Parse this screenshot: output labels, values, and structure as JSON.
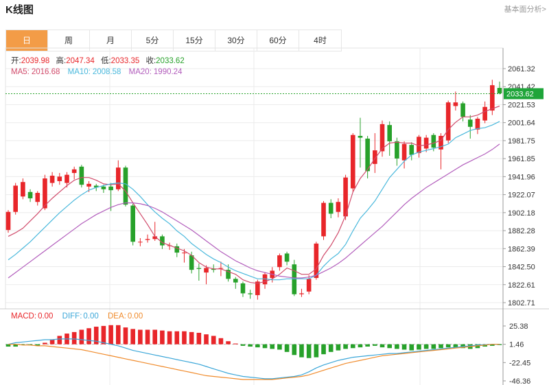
{
  "header": {
    "title": "K线图",
    "more_link": "基本面分析>"
  },
  "tabs": [
    {
      "label": "日",
      "active": true
    },
    {
      "label": "周",
      "active": false
    },
    {
      "label": "月",
      "active": false
    },
    {
      "label": "5分",
      "active": false
    },
    {
      "label": "15分",
      "active": false
    },
    {
      "label": "30分",
      "active": false
    },
    {
      "label": "60分",
      "active": false
    },
    {
      "label": "4时",
      "active": false
    }
  ],
  "ohlc_legend": {
    "open_label": "开:",
    "open": "2039.98",
    "high_label": "高:",
    "high": "2047.34",
    "low_label": "低:",
    "low": "2033.35",
    "close_label": "收:",
    "close": "2033.62"
  },
  "ma_legend": {
    "ma5_label": "MA5:",
    "ma5": "2016.68",
    "ma10_label": "MA10:",
    "ma10": "2008.58",
    "ma20_label": "MA20:",
    "ma20": "1990.24"
  },
  "macd_legend": {
    "macd_label": "MACD:",
    "macd": "0.00",
    "diff_label": "DIFF:",
    "diff": "0.00",
    "dea_label": "DEA:",
    "dea": "0.00"
  },
  "colors": {
    "up": "#e8262a",
    "down": "#27a12a",
    "ma5": "#d04a6a",
    "ma10": "#49b8dc",
    "ma20": "#b25dbc",
    "diff": "#3aa6d8",
    "dea": "#f08a2a",
    "last_price_bg": "#1fa53a",
    "grid": "#ebebeb"
  },
  "chart_data": [
    {
      "type": "candlestick",
      "ylim": [
        1802.71,
        2061.32
      ],
      "yticks": [
        2061.32,
        2041.42,
        2021.53,
        2001.64,
        1981.75,
        1961.85,
        1941.96,
        1922.07,
        1902.18,
        1882.28,
        1862.39,
        1842.5,
        1822.61,
        1802.71
      ],
      "last_price": 2033.62,
      "candles": [
        [
          1883,
          1903,
          1880,
          1905
        ],
        [
          1903,
          1932,
          1900,
          1935
        ],
        [
          1920,
          1936,
          1917,
          1940
        ],
        [
          1925,
          1918,
          1914,
          1928
        ],
        [
          1914,
          1924,
          1910,
          1926
        ],
        [
          1907,
          1940,
          1905,
          1944
        ],
        [
          1935,
          1943,
          1931,
          1947
        ],
        [
          1937,
          1942,
          1933,
          1946
        ],
        [
          1935,
          1944,
          1930,
          1947
        ],
        [
          1946,
          1950,
          1939,
          1953
        ],
        [
          1953,
          1933,
          1930,
          1955
        ],
        [
          1931,
          1934,
          1925,
          1937
        ],
        [
          1932,
          1930,
          1926,
          1934
        ],
        [
          1931,
          1928,
          1924,
          1933
        ],
        [
          1931,
          1927,
          1904,
          1935
        ],
        [
          1928,
          1952,
          1926,
          1960
        ],
        [
          1952,
          1911,
          1909,
          1954
        ],
        [
          1910,
          1870,
          1866,
          1912
        ],
        [
          1870,
          1870,
          1865,
          1874
        ],
        [
          1872,
          1873,
          1869,
          1878
        ],
        [
          1873,
          1876,
          1871,
          1892
        ],
        [
          1876,
          1866,
          1862,
          1878
        ],
        [
          1866,
          1866,
          1861,
          1869
        ],
        [
          1865,
          1858,
          1853,
          1868
        ],
        [
          1858,
          1858,
          1847,
          1862
        ],
        [
          1855,
          1839,
          1835,
          1859
        ],
        [
          1841,
          1840,
          1827,
          1846
        ],
        [
          1836,
          1841,
          1823,
          1844
        ],
        [
          1840,
          1839,
          1836,
          1845
        ],
        [
          1841,
          1841,
          1832,
          1848
        ],
        [
          1839,
          1829,
          1826,
          1845
        ],
        [
          1829,
          1825,
          1818,
          1831
        ],
        [
          1824,
          1813,
          1809,
          1826
        ],
        [
          1813,
          1812,
          1807,
          1817
        ],
        [
          1811,
          1826,
          1806,
          1828
        ],
        [
          1823,
          1834,
          1818,
          1836
        ],
        [
          1830,
          1838,
          1825,
          1842
        ],
        [
          1842,
          1855,
          1838,
          1857
        ],
        [
          1857,
          1848,
          1844,
          1859
        ],
        [
          1845,
          1812,
          1810,
          1850
        ],
        [
          1812,
          1813,
          1809,
          1818
        ],
        [
          1815,
          1829,
          1812,
          1833
        ],
        [
          1830,
          1868,
          1828,
          1870
        ],
        [
          1876,
          1913,
          1872,
          1915
        ],
        [
          1913,
          1901,
          1896,
          1917
        ],
        [
          1903,
          1914,
          1897,
          1918
        ],
        [
          1898,
          1941,
          1894,
          1944
        ],
        [
          1929,
          1988,
          1925,
          1990
        ],
        [
          1987,
          1985,
          1952,
          2007
        ],
        [
          1984,
          1948,
          1940,
          1987
        ],
        [
          1956,
          1971,
          1946,
          1990
        ],
        [
          1970,
          2000,
          1964,
          2004
        ],
        [
          1999,
          1981,
          1965,
          2003
        ],
        [
          1981,
          1962,
          1954,
          1985
        ],
        [
          1960,
          1978,
          1951,
          1981
        ],
        [
          1977,
          1966,
          1960,
          1980
        ],
        [
          1968,
          1986,
          1963,
          1988
        ],
        [
          1973,
          1985,
          1969,
          1988
        ],
        [
          1988,
          1974,
          1970,
          1990
        ],
        [
          1972,
          1987,
          1950,
          1990
        ],
        [
          1982,
          2024,
          1979,
          2026
        ],
        [
          2020,
          2024,
          2015,
          2036
        ],
        [
          2023,
          2008,
          2003,
          2025
        ],
        [
          2005,
          1997,
          1984,
          2010
        ],
        [
          1994,
          2006,
          1989,
          2008
        ],
        [
          2004,
          2019,
          2001,
          2025
        ],
        [
          2015,
          2043,
          2010,
          2049
        ],
        [
          2040,
          2034,
          2033,
          2047
        ]
      ],
      "ma5": [
        1876,
        1880,
        1885,
        1893,
        1901,
        1910,
        1918,
        1925,
        1932,
        1938,
        1941,
        1941,
        1938,
        1934,
        1933,
        1934,
        1926,
        1913,
        1901,
        1889,
        1876,
        1869,
        1866,
        1863,
        1860,
        1855,
        1847,
        1842,
        1840,
        1840,
        1837,
        1834,
        1828,
        1825,
        1824,
        1826,
        1829,
        1834,
        1841,
        1838,
        1834,
        1834,
        1840,
        1855,
        1866,
        1880,
        1899,
        1925,
        1940,
        1950,
        1962,
        1973,
        1979,
        1980,
        1979,
        1979,
        1976,
        1977,
        1979,
        1982,
        1994,
        2002,
        2008,
        2008,
        2010,
        2014,
        2017,
        2020
      ],
      "ma10": [
        1850,
        1856,
        1863,
        1870,
        1878,
        1886,
        1894,
        1902,
        1909,
        1916,
        1922,
        1927,
        1930,
        1932,
        1934,
        1935,
        1934,
        1928,
        1920,
        1911,
        1903,
        1896,
        1890,
        1882,
        1876,
        1868,
        1862,
        1856,
        1851,
        1847,
        1842,
        1838,
        1835,
        1832,
        1829,
        1829,
        1828,
        1828,
        1829,
        1829,
        1829,
        1829,
        1833,
        1843,
        1851,
        1857,
        1867,
        1882,
        1896,
        1905,
        1915,
        1928,
        1941,
        1950,
        1959,
        1966,
        1969,
        1971,
        1973,
        1975,
        1978,
        1985,
        1989,
        1993,
        1995,
        1996,
        1999,
        2003
      ],
      "ma20": [
        1830,
        1836,
        1842,
        1848,
        1854,
        1860,
        1866,
        1872,
        1878,
        1884,
        1890,
        1895,
        1900,
        1904,
        1908,
        1911,
        1913,
        1913,
        1912,
        1910,
        1907,
        1903,
        1898,
        1893,
        1888,
        1883,
        1877,
        1871,
        1865,
        1859,
        1854,
        1849,
        1845,
        1841,
        1838,
        1836,
        1834,
        1832,
        1831,
        1830,
        1830,
        1831,
        1833,
        1837,
        1841,
        1846,
        1852,
        1859,
        1866,
        1873,
        1880,
        1887,
        1895,
        1903,
        1911,
        1918,
        1924,
        1930,
        1935,
        1940,
        1945,
        1950,
        1955,
        1959,
        1963,
        1967,
        1972,
        1978
      ]
    },
    {
      "type": "macd",
      "ylim": [
        -46.36,
        25.38
      ],
      "yticks": [
        25.38,
        1.46,
        -22.45,
        -46.36
      ],
      "hist": [
        -3,
        -3,
        -1,
        -1,
        -2,
        2,
        6,
        11,
        14,
        16,
        19,
        21,
        23,
        24,
        25,
        25,
        22,
        20,
        19,
        19,
        19,
        18,
        17,
        17,
        17,
        16,
        15,
        13,
        11,
        8,
        4,
        1,
        -2,
        -3,
        -4,
        -5,
        -6,
        -7,
        -10,
        -14,
        -17,
        -18,
        -17,
        -13,
        -10,
        -8,
        -6,
        -5,
        -4,
        -3,
        -2,
        -4,
        -5,
        -6,
        -7,
        -8,
        -7,
        -6,
        -6,
        -5,
        -4,
        -4,
        -5,
        -6,
        -5,
        -3,
        -2,
        -1
      ],
      "diff": [
        0,
        2,
        3,
        4,
        5,
        6,
        6,
        7,
        7,
        7,
        6,
        5,
        4,
        2,
        0,
        -2,
        -5,
        -8,
        -10,
        -12,
        -14,
        -16,
        -18,
        -20,
        -22,
        -24,
        -26,
        -29,
        -32,
        -35,
        -38,
        -40,
        -42,
        -43,
        -44,
        -45,
        -45,
        -44,
        -43,
        -42,
        -40,
        -36,
        -31,
        -27,
        -24,
        -21,
        -19,
        -17,
        -16,
        -15,
        -14,
        -13,
        -12,
        -12,
        -11,
        -10,
        -9,
        -8,
        -7,
        -6,
        -5,
        -4,
        -3,
        -2,
        -1,
        -0.5,
        0,
        0
      ],
      "dea": [
        0,
        0,
        -1,
        -1,
        -2,
        -2,
        -3,
        -4,
        -5,
        -6,
        -7,
        -9,
        -11,
        -13,
        -15,
        -17,
        -19,
        -21,
        -23,
        -25,
        -27,
        -29,
        -31,
        -33,
        -35,
        -37,
        -39,
        -41,
        -42,
        -43,
        -44,
        -45,
        -46,
        -46,
        -46,
        -46,
        -46,
        -45,
        -44,
        -43,
        -42,
        -40,
        -37,
        -34,
        -31,
        -28,
        -25,
        -23,
        -21,
        -19,
        -17,
        -15,
        -14,
        -13,
        -12,
        -11,
        -10,
        -9,
        -8,
        -7,
        -6,
        -5,
        -4,
        -3,
        -2,
        -1,
        0,
        0
      ]
    }
  ]
}
